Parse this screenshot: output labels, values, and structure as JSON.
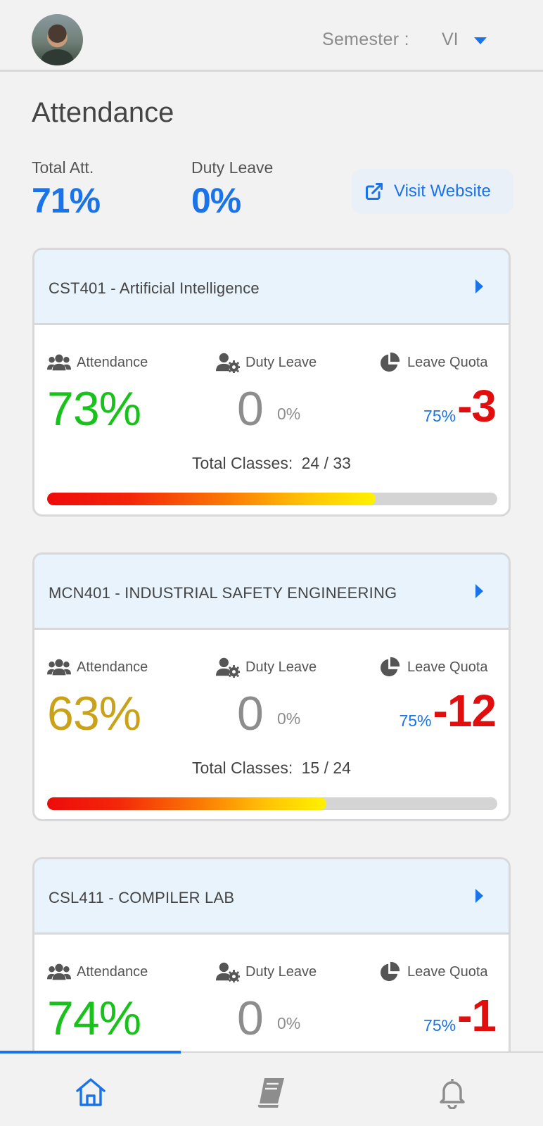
{
  "header": {
    "semester_label": "Semester :",
    "semester_value": "VI"
  },
  "page": {
    "title": "Attendance",
    "total_att_label": "Total Att.",
    "total_att_value": "71%",
    "duty_leave_label": "Duty Leave",
    "duty_leave_value": "0%",
    "visit_website_label": "Visit Website"
  },
  "colors": {
    "accent": "#1a73e8",
    "green": "#18c21a",
    "amber": "#c9a21a",
    "red": "#e20e0e",
    "header_bg": "#e9f3fc"
  },
  "icons": {
    "attendance": "users-icon",
    "duty_leave": "user-gear-icon",
    "leave_quota": "pie-chart-icon",
    "visit": "external-link-icon",
    "nav": [
      "home-icon",
      "book-icon",
      "bell-icon"
    ]
  },
  "cards": [
    {
      "title": "CST401 - Artificial Intelligence",
      "attendance_label": "Attendance",
      "attendance_value": "73%",
      "attendance_color": "#18c21a",
      "duty_label": "Duty Leave",
      "duty_value": "0",
      "duty_pct": "0%",
      "quota_label": "Leave Quota",
      "quota_pct": "75%",
      "quota_value": "-3",
      "total_label": "Total Classes:",
      "total_value": "24 / 33",
      "progress": 0.73
    },
    {
      "title": "MCN401 - INDUSTRIAL SAFETY ENGINEERING",
      "attendance_label": "Attendance",
      "attendance_value": "63%",
      "attendance_color": "#c9a21a",
      "duty_label": "Duty Leave",
      "duty_value": "0",
      "duty_pct": "0%",
      "quota_label": "Leave Quota",
      "quota_pct": "75%",
      "quota_value": "-12",
      "total_label": "Total Classes:",
      "total_value": "15 / 24",
      "progress": 0.62
    },
    {
      "title": "CSL411 - COMPILER LAB",
      "attendance_label": "Attendance",
      "attendance_value": "74%",
      "attendance_color": "#18c21a",
      "duty_label": "Duty Leave",
      "duty_value": "0",
      "duty_pct": "0%",
      "quota_label": "Leave Quota",
      "quota_pct": "75%",
      "quota_value": "-1"
    }
  ]
}
